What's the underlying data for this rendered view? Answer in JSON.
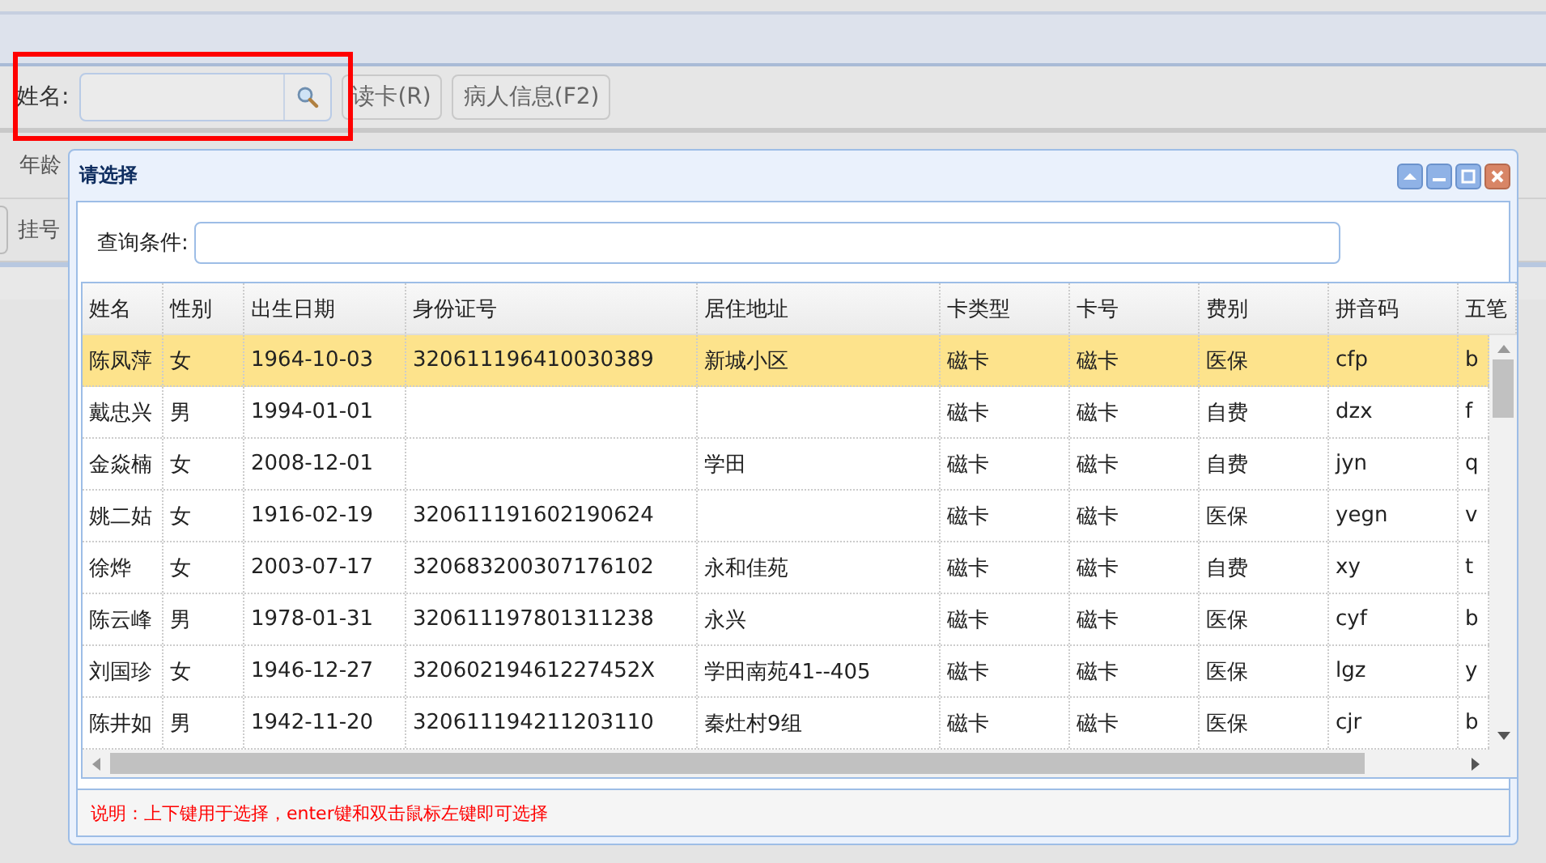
{
  "toolbar": {
    "name_label": "姓名:",
    "buttons": [
      "读卡(R)",
      "病人信息(F2)"
    ]
  },
  "background_labels": [
    "年龄",
    "挂号"
  ],
  "dialog": {
    "title": "请选择",
    "query_label": "查询条件:",
    "table": {
      "columns": [
        "姓名",
        "性别",
        "出生日期",
        "身份证号",
        "居住地址",
        "卡类型",
        "卡号",
        "费别",
        "拼音码",
        "五笔"
      ],
      "rows": [
        {
          "selected": true,
          "cells": [
            "陈凤萍",
            "女",
            "1964-10-03",
            "320611196410030389",
            "新城小区",
            "磁卡",
            "磁卡",
            "医保",
            "cfp",
            "b"
          ]
        },
        {
          "selected": false,
          "cells": [
            "戴忠兴",
            "男",
            "1994-01-01",
            "",
            "",
            "磁卡",
            "磁卡",
            "自费",
            "dzx",
            "f"
          ]
        },
        {
          "selected": false,
          "cells": [
            "金焱楠",
            "女",
            "2008-12-01",
            "",
            "学田",
            "磁卡",
            "磁卡",
            "自费",
            "jyn",
            "q"
          ]
        },
        {
          "selected": false,
          "cells": [
            "姚二姑",
            "女",
            "1916-02-19",
            "320611191602190624",
            "",
            "磁卡",
            "磁卡",
            "医保",
            "yegn",
            "v"
          ]
        },
        {
          "selected": false,
          "cells": [
            "徐烨",
            "女",
            "2003-07-17",
            "320683200307176102",
            "永和佳苑",
            "磁卡",
            "磁卡",
            "自费",
            "xy",
            "t"
          ]
        },
        {
          "selected": false,
          "cells": [
            "陈云峰",
            "男",
            "1978-01-31",
            "320611197801311238",
            "永兴",
            "磁卡",
            "磁卡",
            "医保",
            "cyf",
            "b"
          ]
        },
        {
          "selected": false,
          "cells": [
            "刘国珍",
            "女",
            "1946-12-27",
            "32060219461227452X",
            "学田南苑41--405",
            "磁卡",
            "磁卡",
            "医保",
            "lgz",
            "y"
          ]
        },
        {
          "selected": false,
          "cells": [
            "陈井如",
            "男",
            "1942-11-20",
            "320611194211203110",
            "秦灶村9组",
            "磁卡",
            "磁卡",
            "医保",
            "cjr",
            "b"
          ]
        }
      ]
    },
    "note": "说明：上下键用于选择，enter键和双击鼠标左键即可选择"
  }
}
